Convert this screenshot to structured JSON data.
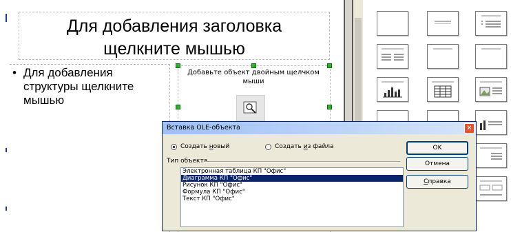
{
  "slide": {
    "title_placeholder": "Для добавления заголовка\nщелкните мышью",
    "outline_bullet": "•",
    "outline_placeholder": "Для добавления\nструктуры щелкните\nмышью",
    "object_placeholder": "Добавьте объект двойным щелчком мыши"
  },
  "layouts_panel": {
    "thumbnails": [
      "blank",
      "title-only",
      "title-content",
      "title-two-columns",
      "title",
      "title-wide",
      "title-chart",
      "title-table",
      "title-image-text",
      "title-text-chart",
      "title-chart-text",
      "title-text-object",
      "title-two-content",
      "title-four-content",
      "title-stacked"
    ]
  },
  "dialog": {
    "title": "Вставка OLE-объекта",
    "close_label": "✕",
    "radio_new": {
      "before": "Создать ",
      "underlined": "н",
      "after": "овый",
      "checked": true
    },
    "radio_from_file": {
      "before": "Создать ",
      "underlined": "и",
      "after": "з файла",
      "checked": false
    },
    "type_label": "Тип объекта",
    "object_types": [
      "Электронная таблица КП \"Офис\"",
      "Диаграмма КП \"Офис\"",
      "Рисунок КП \"Офис\"",
      "Формула КП \"Офис\"",
      "Текст КП \"Офис\""
    ],
    "selected_type": "Диаграмма КП \"Офис\"",
    "ok_label": "OK",
    "cancel_label": "Отмена",
    "help_label": {
      "underlined": "С",
      "after": "правка"
    }
  }
}
